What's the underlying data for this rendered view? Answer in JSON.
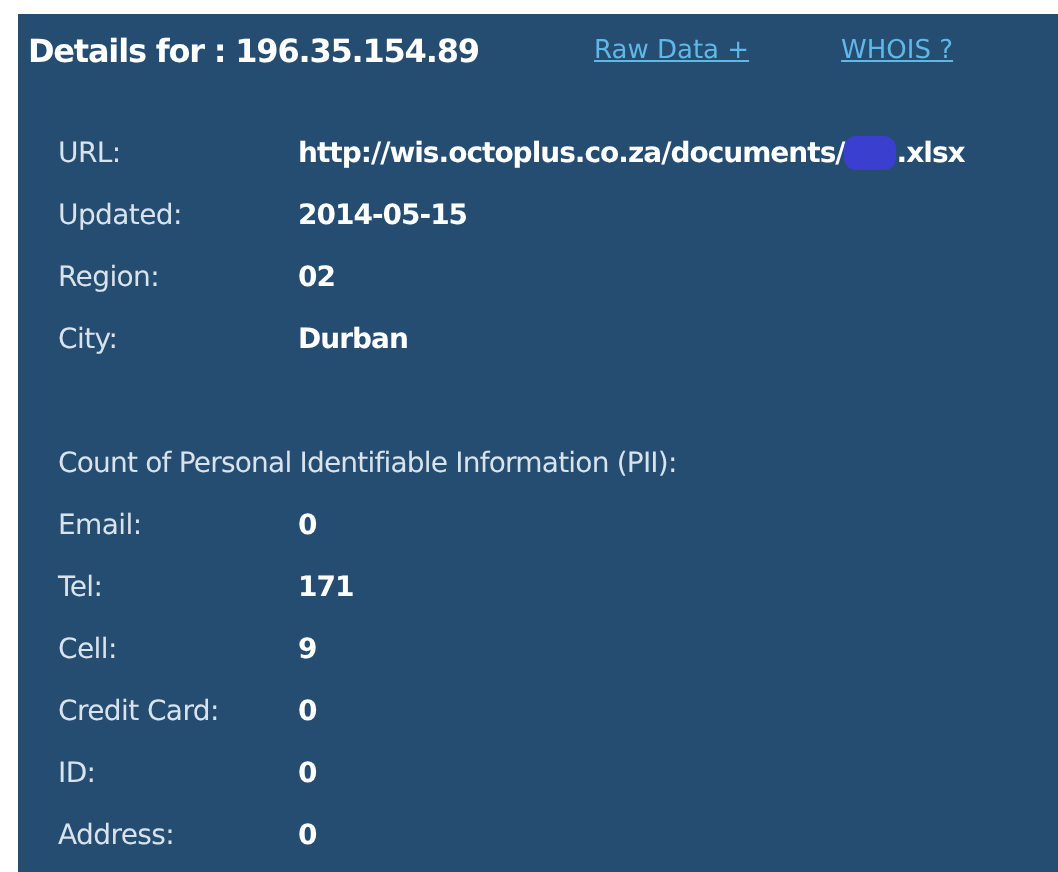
{
  "header": {
    "title": "Details for : 196.35.154.89",
    "links": [
      "Raw Data +",
      "WHOIS ?"
    ]
  },
  "details": [
    {
      "label": "URL:",
      "value": "http://wis.octoplus.co.za/documents/",
      "suffix": ".xlsx",
      "redacted": true
    },
    {
      "label": "Updated:",
      "value": "2014-05-15",
      "redacted": false
    },
    {
      "label": "Region:",
      "value": "02",
      "redacted": false
    },
    {
      "label": "City:",
      "value": "Durban",
      "redacted": false
    }
  ],
  "pii": {
    "title": "Count of Personal Identifiable Information (PII):",
    "rows": [
      {
        "label": "Email:",
        "value": "0"
      },
      {
        "label": "Tel:",
        "value": "171"
      },
      {
        "label": "Cell:",
        "value": "9"
      },
      {
        "label": "Credit Card:",
        "value": "0"
      },
      {
        "label": "ID:",
        "value": "0"
      },
      {
        "label": "Address:",
        "value": "0"
      }
    ]
  }
}
